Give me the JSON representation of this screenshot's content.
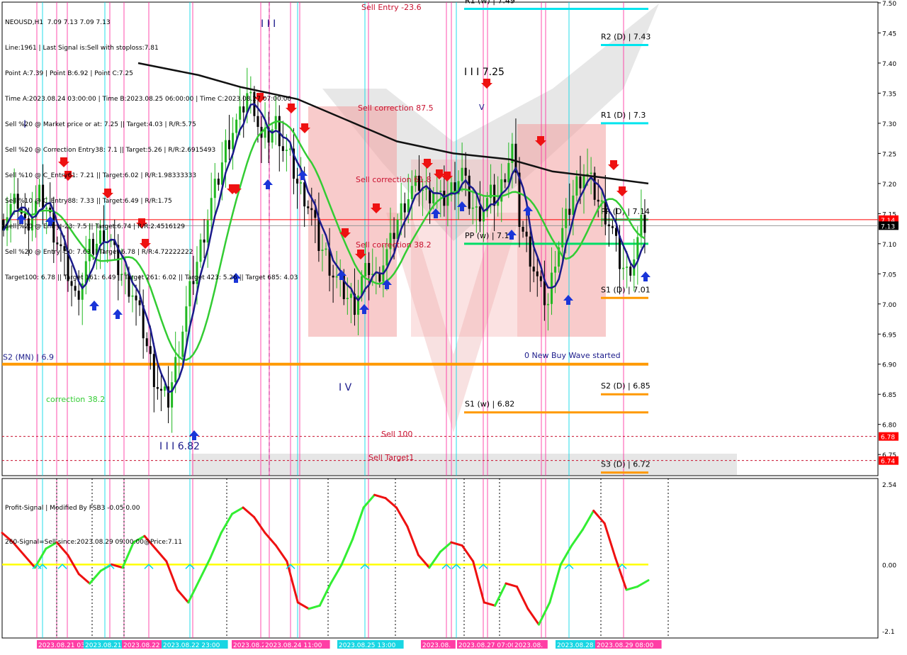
{
  "window": {
    "symbol_line": "NEOUSD,H1  7.09 7.13 7.09 7.13"
  },
  "info_lines": [
    "Line:1961 | Last Signal is:Sell with stoploss:7.81",
    "Point A:7.39 | Point B:6.92 | Point C:7.25",
    "Time A:2023.08.24 03:00:00 | Time B:2023.08.25 06:00:00 | Time C:2023.08.27 07:00:00",
    "Sell %20 @ Market price or at: 7.25 || Target:4.03 | R/R:5.75",
    "Sell %20 @ Correction Entry38: 7.1 || Target:5.26 | R/R:2.6915493",
    "Sell %10 @ C_Entry61: 7.21 || Target:6.02 | R/R:1.98333333",
    "Sell %10 @ C_Entry88: 7.33 || Target:6.49 | R/R:1.75",
    "Sell %20 @ Entry -23: 7.5 || Target:6.74 | R/R:2.4516129",
    "Sell %20 @ Entry -50: 7.63 || Target:6.78 | R/R:4.72222222",
    "Target100: 6.78 || Target 161: 6.49 || Target 261: 6.02 || Target 423: 5.26 || Target 685: 4.03"
  ],
  "sub_info": {
    "line1": "Profit-Signal | Modified By FSB3 -0.05 0.00",
    "line2": "260-Signal=Sell since:2023.08.29 09:00:00@Price:7.11"
  },
  "colors": {
    "background": "#ffffff",
    "bear_candle": "#000000",
    "bull_candle": "#22b822",
    "ma_fast": "#1a1a8a",
    "ma_mid": "#33cc33",
    "ma_slow": "#111111",
    "pivot_cyan": "#00e5ee",
    "pivot_orange": "#ff9900",
    "pivot_green": "#00dd66",
    "pink_zone": "#f2a0a0",
    "osc_up": "#33ee33",
    "osc_down": "#ee1111",
    "zero_line": "#ffff00",
    "current_price_line": "#ff0000"
  },
  "chart_data": [
    {
      "type": "candlestick",
      "symbol": "NEOUSD",
      "timeframe": "H1",
      "ylim": [
        6.72,
        7.5
      ],
      "y_ticks": [
        "7.50",
        "7.45",
        "7.40",
        "7.35",
        "7.30",
        "7.25",
        "7.20",
        "7.15",
        "7.10",
        "7.05",
        "7.00",
        "6.95",
        "6.90",
        "6.85",
        "6.80",
        "6.75"
      ],
      "current_price": "7.13",
      "price_tags": [
        {
          "label": "7.14",
          "value": 7.14,
          "color": "#ff0000"
        },
        {
          "label": "7.13",
          "value": 7.13,
          "color": "#000000"
        },
        {
          "label": "6.78",
          "value": 6.78,
          "color": "#ff0000"
        },
        {
          "label": "6.74",
          "value": 6.74,
          "color": "#ff0000"
        }
      ],
      "levels": [
        {
          "label": "S2 (MN) | 6.9",
          "value": 6.9,
          "color": "#ff9900",
          "from": 0.0,
          "to": 1.0
        },
        {
          "label": "R2 (D) | 7.43",
          "value": 7.43,
          "color": "#00e5ee",
          "from": 0.928,
          "to": 1.0
        },
        {
          "label": "R1 (D) | 7.3",
          "value": 7.3,
          "color": "#00e5ee",
          "from": 0.928,
          "to": 1.0
        },
        {
          "label": "PP (D) | 7.14",
          "value": 7.14,
          "color": "#00dd66",
          "from": 0.928,
          "to": 1.0
        },
        {
          "label": "S1 (D) | 7.01",
          "value": 7.01,
          "color": "#ff9900",
          "from": 0.928,
          "to": 1.0
        },
        {
          "label": "S2 (D) | 6.85",
          "value": 6.85,
          "color": "#ff9900",
          "from": 0.928,
          "to": 1.0
        },
        {
          "label": "S3 (D) | 6.72",
          "value": 6.72,
          "color": "#ff9900",
          "from": 0.928,
          "to": 1.0
        },
        {
          "label": "PP (w) | 7.1",
          "value": 7.1,
          "color": "#00dd66",
          "from": 0.715,
          "to": 1.0
        },
        {
          "label": "S1 (w) | 6.82",
          "value": 6.82,
          "color": "#ff9900",
          "from": 0.715,
          "to": 1.0
        },
        {
          "label": "R1 (w) | 7.49",
          "value": 7.49,
          "color": "#00e5ee",
          "from": 0.715,
          "to": 1.0
        }
      ],
      "annotations": [
        {
          "text": "Sell Entry -23.6",
          "value": 7.49,
          "color": "#c8102e"
        },
        {
          "text": "Sell correction 87.5",
          "value": 7.33,
          "color": "#c8102e"
        },
        {
          "text": "Sell correction 61.8",
          "value": 7.21,
          "color": "#c8102e"
        },
        {
          "text": "Sell correction 38.2",
          "value": 7.09,
          "color": "#c8102e"
        },
        {
          "text": "Sell 100",
          "value": 6.78,
          "color": "#c8102e"
        },
        {
          "text": "Sell Target1",
          "value": 6.74,
          "color": "#c8102e"
        },
        {
          "text": "0 New Buy Wave started",
          "value": 6.9,
          "color": "#1a1a8a"
        },
        {
          "text": "correction 38.2",
          "value": 6.83,
          "color": "#33cc33"
        },
        {
          "text": "I I I 7.25",
          "value": 7.39,
          "color": "#000000"
        },
        {
          "text": "I I I 6.82",
          "value": 6.75,
          "color": "#1a1a8a"
        },
        {
          "text": "I V",
          "value": 6.86,
          "color": "#1a1a8a"
        },
        {
          "text": "I I I",
          "value": 7.49,
          "color": "#1a1a8a"
        },
        {
          "text": "V",
          "value": 7.32,
          "color": "#1a1a8a"
        },
        {
          "text": "I",
          "value": 7.3,
          "color": "#1a1a8a"
        }
      ],
      "sample_closes": [
        7.14,
        7.16,
        7.17,
        7.13,
        7.15,
        7.18,
        7.16,
        7.12,
        7.09,
        7.05,
        7.01,
        7.04,
        7.09,
        7.1,
        7.12,
        7.1,
        7.06,
        7.04,
        7.02,
        6.98,
        6.93,
        6.88,
        6.85,
        6.84,
        6.9,
        6.96,
        7.02,
        7.07,
        7.12,
        7.17,
        7.21,
        7.26,
        7.29,
        7.31,
        7.35,
        7.33,
        7.27,
        7.28,
        7.3,
        7.26,
        7.24,
        7.2,
        7.18,
        7.15,
        7.1,
        7.08,
        7.05,
        7.03,
        7.01,
        7.0,
        7.04,
        7.06,
        7.04,
        7.07,
        7.1,
        7.14,
        7.17,
        7.19,
        7.2,
        7.18,
        7.19,
        7.17,
        7.18,
        7.2,
        7.22,
        7.17,
        7.15,
        7.16,
        7.18,
        7.17,
        7.22,
        7.26,
        7.14,
        7.1,
        7.06,
        7.02,
        7.0,
        7.08,
        7.12,
        7.16,
        7.2,
        7.22,
        7.2,
        7.17,
        7.15,
        7.12,
        7.07,
        7.05,
        7.08,
        7.13
      ]
    },
    {
      "type": "line",
      "name": "Profit-Signal",
      "ylim": [
        -2.1,
        2.54
      ],
      "y_ticks": [
        "2.54",
        "0.00",
        "-2.1"
      ],
      "zero_value": 0.0,
      "values": [
        1.0,
        0.7,
        0.3,
        -0.1,
        0.5,
        0.7,
        0.3,
        -0.3,
        -0.6,
        -0.2,
        0.0,
        -0.1,
        0.7,
        0.9,
        0.5,
        0.1,
        -0.8,
        -1.2,
        -0.5,
        0.2,
        1.0,
        1.6,
        1.8,
        1.5,
        1.0,
        0.6,
        0.1,
        -1.2,
        -1.4,
        -1.3,
        -0.6,
        0.0,
        0.8,
        1.8,
        2.2,
        2.1,
        1.8,
        1.2,
        0.3,
        -0.1,
        0.4,
        0.7,
        0.6,
        0.1,
        -1.2,
        -1.3,
        -0.6,
        -0.7,
        -1.4,
        -1.9,
        -1.2,
        0.0,
        0.6,
        1.1,
        1.7,
        1.3,
        0.2,
        -0.8,
        -0.7,
        -0.5
      ]
    }
  ],
  "time_axis": {
    "labels": [
      {
        "text": "2023.08.21 03:00",
        "highlight": "pink"
      },
      {
        "text": "2023.08.21",
        "highlight": "cyan"
      },
      {
        "text": "2023.08.22",
        "highlight": "pink"
      },
      {
        "text": "2023.08.22 23:00",
        "highlight": "cyan"
      },
      {
        "text": "2023.08.2",
        "highlight": "pink"
      },
      {
        "text": "2023.08.24 11:00",
        "highlight": "pink"
      },
      {
        "text": "2023.08.25 13:00",
        "highlight": "cyan"
      },
      {
        "text": "2023.08.",
        "highlight": "pink"
      },
      {
        "text": "2023.08.27 07:00",
        "highlight": "pink"
      },
      {
        "text": "2023.08.",
        "highlight": "pink"
      },
      {
        "text": "2023.08.28 13:00",
        "highlight": "cyan"
      },
      {
        "text": "2023.08.29 08:00",
        "highlight": "pink"
      }
    ]
  }
}
